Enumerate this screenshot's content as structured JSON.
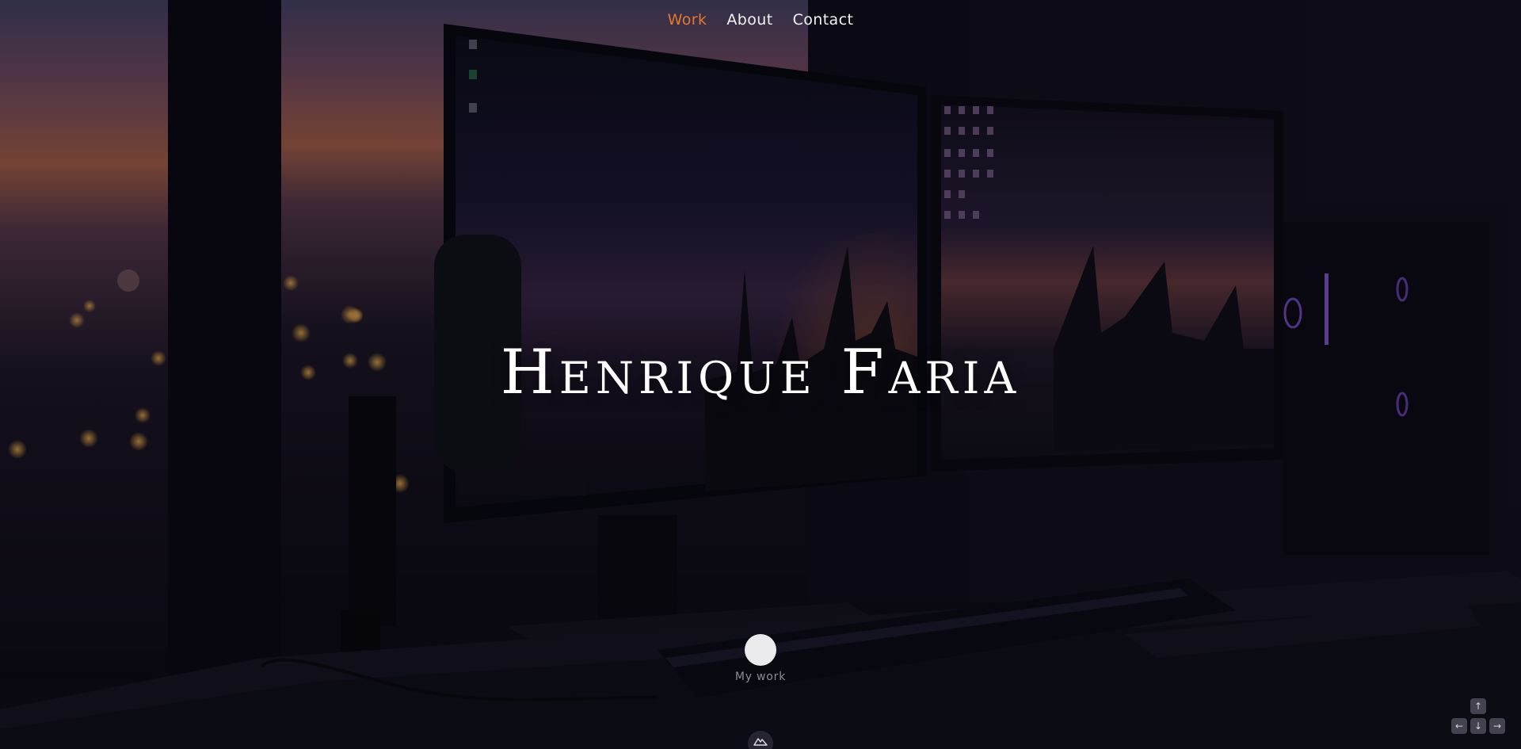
{
  "nav": {
    "items": [
      {
        "label": "Work",
        "active": true
      },
      {
        "label": "About",
        "active": false
      },
      {
        "label": "Contact",
        "active": false
      }
    ]
  },
  "hero": {
    "title": "Henrique Faria",
    "background": "desk-setup-photo"
  },
  "cta": {
    "label": "My work"
  },
  "colors": {
    "accent": "#e8772e",
    "text": "#f2f2f4",
    "muted": "#8d8b98"
  },
  "icons": {
    "logo": "mountain-logo-icon",
    "arrow_up": "arrow-up-icon",
    "arrow_left": "arrow-left-icon",
    "arrow_down": "arrow-down-icon",
    "arrow_right": "arrow-right-icon"
  }
}
